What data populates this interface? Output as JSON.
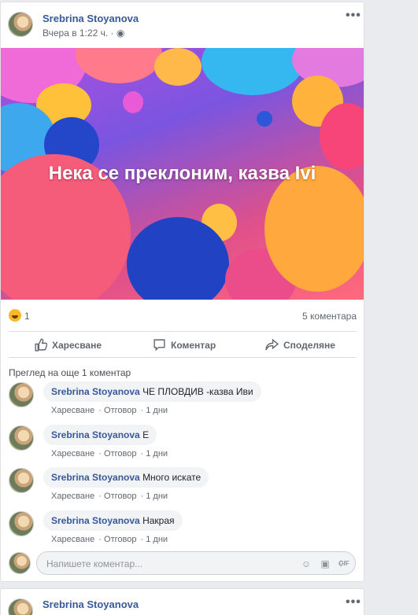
{
  "post": {
    "author": "Srebrina Stoyanova",
    "time": "Вчера в 1:22 ч.",
    "image_text": "Нека се преклоним, казва Ivi",
    "reactions_count": "1",
    "comments_count": "5 коментара",
    "actions": {
      "like": "Харесване",
      "comment": "Коментар",
      "share": "Споделяне"
    },
    "view_more": "Преглед на още 1 коментар",
    "comments": [
      {
        "author": "Srebrina Stoyanova",
        "text": "ЧЕ ПЛОВДИВ -казва Иви",
        "like": "Харесване",
        "reply": "Отговор",
        "age": "1 дни"
      },
      {
        "author": "Srebrina Stoyanova",
        "text": "Е",
        "like": "Харесване",
        "reply": "Отговор",
        "age": "1 дни"
      },
      {
        "author": "Srebrina Stoyanova",
        "text": "Много искате",
        "like": "Харесване",
        "reply": "Отговор",
        "age": "1 дни"
      },
      {
        "author": "Srebrina Stoyanova",
        "text": "Накрая",
        "like": "Харесване",
        "reply": "Отговор",
        "age": "1 дни"
      }
    ],
    "composer_placeholder": "Напишете коментар..."
  },
  "next_post": {
    "author": "Srebrina Stoyanova"
  },
  "colors": {
    "link": "#385898",
    "muted": "#606770",
    "background": "#e9ebee"
  }
}
